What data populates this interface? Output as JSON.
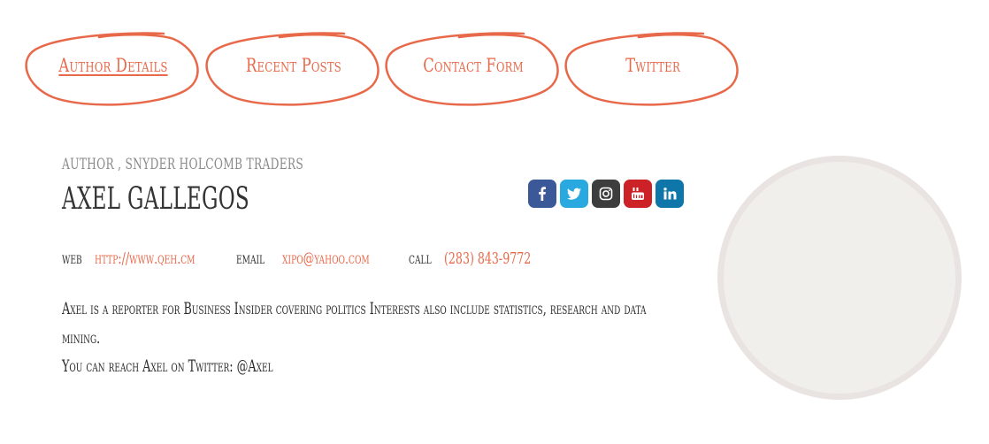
{
  "tabs": [
    {
      "label": "Author Details",
      "active": true
    },
    {
      "label": "Recent Posts",
      "active": false
    },
    {
      "label": "Contact Form",
      "active": false
    },
    {
      "label": "Twitter",
      "active": false
    }
  ],
  "author": {
    "role": "AUTHOR , SNYDER HOLCOMB TRADERS",
    "name": "AXEL GALLEGOS"
  },
  "social": [
    {
      "name": "facebook",
      "icon": "facebook-icon",
      "color": "#3b5998"
    },
    {
      "name": "twitter",
      "icon": "twitter-icon",
      "color": "#2aa9e0"
    },
    {
      "name": "instagram",
      "icon": "instagram-icon",
      "color": "#3d3d3d"
    },
    {
      "name": "youtube",
      "icon": "youtube-icon",
      "color": "#cc2127"
    },
    {
      "name": "linkedin",
      "icon": "linkedin-icon",
      "color": "#0e76a8"
    }
  ],
  "contact": {
    "web_label": "web",
    "web_value": "http://www.qeh.cm",
    "email_label": "email",
    "email_value": "xipo@yahoo.com",
    "call_label": "call",
    "call_value": "(283) 843-9772"
  },
  "bio": {
    "line1": "Axel is a reporter for Business Insider covering politics Interests also include statistics, research and data mining.",
    "line2": "You can reach Axel on Twitter: @Axel"
  },
  "colors": {
    "accent": "#e8694a",
    "text": "#333333",
    "muted": "#8a8a8a"
  }
}
